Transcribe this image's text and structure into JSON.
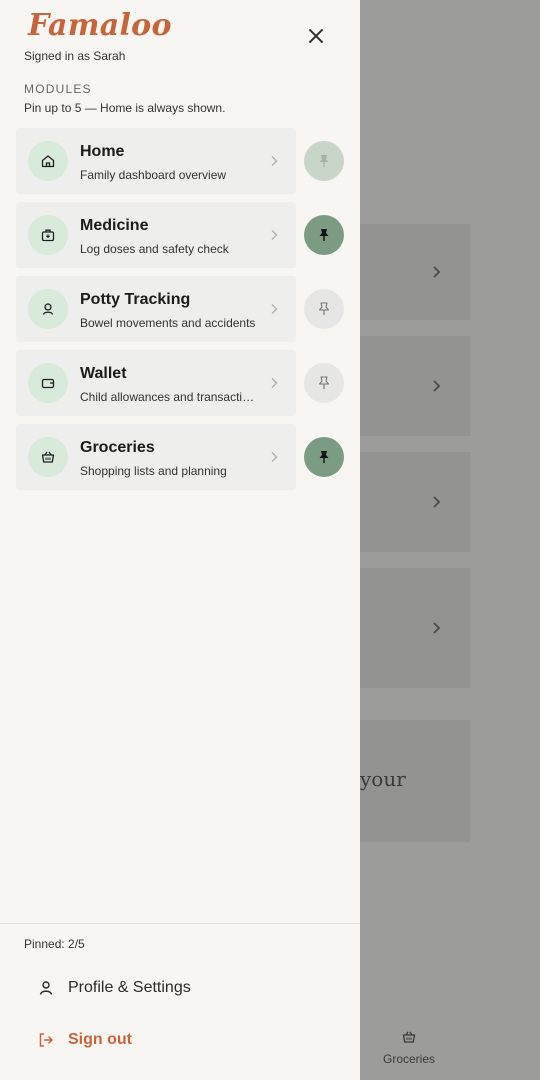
{
  "drawer": {
    "brand": "Famaloo",
    "signed_in": "Signed in as Sarah",
    "close_icon": "close-icon",
    "section_label": "MODULES",
    "section_hint": "Pin up to 5 — Home is always shown.",
    "modules": [
      {
        "title": "Home",
        "description": "Family dashboard overview",
        "icon": "house-icon",
        "pin_state": "locked"
      },
      {
        "title": "Medicine",
        "description": "Log doses and safety check",
        "icon": "medkit-icon",
        "pin_state": "pinned"
      },
      {
        "title": "Potty Tracking",
        "description": "Bowel movements and accidents",
        "icon": "potty-icon",
        "pin_state": "unpinned"
      },
      {
        "title": "Wallet",
        "description": "Child allowances and transactions",
        "icon": "wallet-icon",
        "pin_state": "unpinned"
      },
      {
        "title": "Groceries",
        "description": "Shopping lists and planning",
        "icon": "basket-icon",
        "pin_state": "pinned"
      }
    ],
    "pinned_count": "Pinned: 2/5",
    "profile_label": "Profile & Settings",
    "signout_label": "Sign out"
  },
  "background": {
    "visible_text": "your",
    "bottom_nav_item": "Groceries"
  },
  "colors": {
    "brand": "#c8643c",
    "pinned": "#7b9c82",
    "icon_bg": "#d8ead9",
    "overlay": "#9c9c9a"
  }
}
